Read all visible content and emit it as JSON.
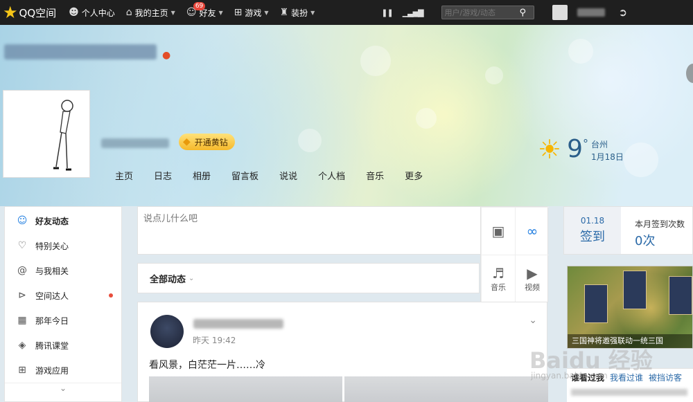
{
  "topbar": {
    "logo_text": "QQ空间",
    "nav": [
      {
        "label": "个人中心",
        "icon": "person-icon"
      },
      {
        "label": "我的主页",
        "icon": "home-icon"
      },
      {
        "label": "好友",
        "icon": "friends-icon",
        "badge": "69"
      },
      {
        "label": "游戏",
        "icon": "grid-icon"
      },
      {
        "label": "装扮",
        "icon": "shirt-icon"
      }
    ],
    "search_placeholder": "用户/游戏/动态"
  },
  "banner": {
    "vip_button": "开通黄钻",
    "weather": {
      "temp": "9",
      "unit": "°",
      "city": "台州",
      "date": "1月18日",
      "icon": "sun-icon"
    },
    "tabs": [
      "主页",
      "日志",
      "相册",
      "留言板",
      "说说",
      "个人档",
      "音乐",
      "更多"
    ]
  },
  "sidebar": {
    "items": [
      {
        "label": "好友动态",
        "icon": "friends-feed-icon",
        "active": true
      },
      {
        "label": "特别关心",
        "icon": "heart-icon"
      },
      {
        "label": "与我相关",
        "icon": "at-icon"
      },
      {
        "label": "空间达人",
        "icon": "play-circle-icon",
        "dot": true
      },
      {
        "label": "那年今日",
        "icon": "calendar-icon"
      },
      {
        "label": "腾讯课堂",
        "icon": "classroom-icon"
      },
      {
        "label": "游戏应用",
        "icon": "apps-icon"
      }
    ],
    "more_icon": "chevron-down-icon"
  },
  "composer": {
    "placeholder": "说点儿什么吧",
    "tools": [
      {
        "label": "",
        "icon": "camera-icon"
      },
      {
        "label": "",
        "icon": "link-icon"
      },
      {
        "label": "音乐",
        "icon": "music-icon"
      },
      {
        "label": "视频",
        "icon": "video-icon"
      }
    ]
  },
  "feed": {
    "filter_label": "全部动态",
    "post": {
      "time": "昨天 19:42",
      "text": "看风景，白茫茫一片……冷"
    }
  },
  "checkin": {
    "date": "01.18",
    "button": "签到",
    "count_label": "本月签到次数",
    "count": "0次"
  },
  "ad": {
    "caption": "三国神将邀强联动一统三国"
  },
  "visitors": {
    "tabs": [
      "谁看过我",
      "我看过谁",
      "被挡访客"
    ]
  },
  "watermark": {
    "main": "Baidu 经验",
    "sub": "jingyan.baidu.com"
  },
  "colors": {
    "accent": "#1f7de0",
    "topbar": "#1f1f1f",
    "vip": "#f6b92b"
  }
}
